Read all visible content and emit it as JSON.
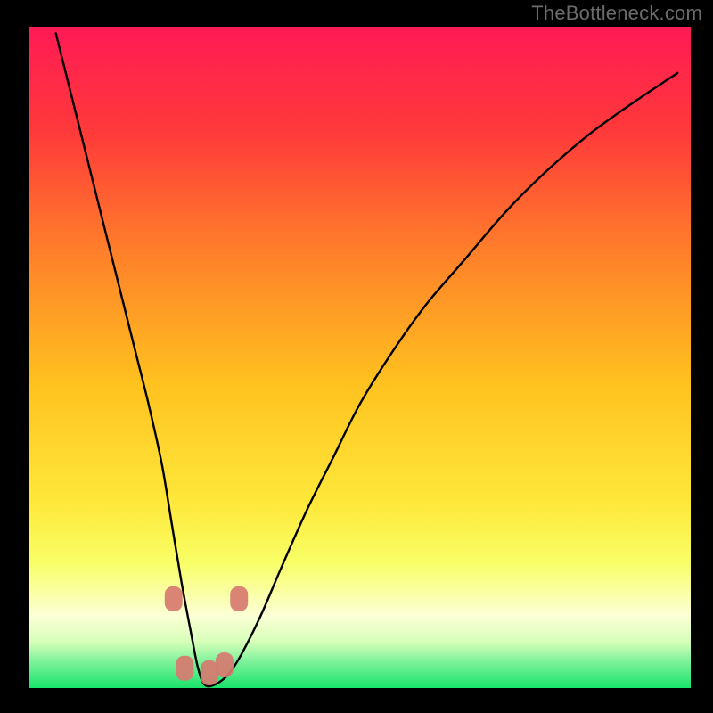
{
  "watermark": "TheBottleneck.com",
  "colors": {
    "black": "#000000",
    "curve": "#000000",
    "marker": "#d77a70",
    "grad_top": "#ff1a55",
    "grad_mid_upper": "#ff7f2a",
    "grad_mid": "#ffd21f",
    "grad_mid_lower": "#f8ff66",
    "grad_pale_yellow": "#fcffd4",
    "grad_green": "#19e36b"
  },
  "chart_data": {
    "type": "line",
    "title": "",
    "xlabel": "",
    "ylabel": "",
    "xlim": [
      0,
      100
    ],
    "ylim": [
      0,
      100
    ],
    "series": [
      {
        "name": "curve",
        "x": [
          4,
          6,
          8,
          10,
          12,
          14,
          16,
          18,
          20,
          21.5,
          23,
          24.5,
          25.5,
          26.5,
          28,
          30,
          32,
          35,
          38,
          42,
          46,
          50,
          55,
          60,
          66,
          72,
          78,
          85,
          92,
          98
        ],
        "values": [
          99,
          91,
          83,
          75,
          67,
          59,
          51,
          43,
          34,
          25,
          16,
          8,
          3,
          0.5,
          0.5,
          2,
          5,
          11,
          18,
          27,
          35,
          43,
          51,
          58,
          65,
          72,
          78,
          84,
          89,
          93
        ]
      }
    ],
    "markers": [
      {
        "x": 21.8,
        "y": 13.5
      },
      {
        "x": 23.5,
        "y": 3.0
      },
      {
        "x": 27.2,
        "y": 2.3
      },
      {
        "x": 29.5,
        "y": 3.5
      },
      {
        "x": 31.7,
        "y": 13.5
      }
    ],
    "marker_style": {
      "shape": "rounded-rect",
      "color": "#d77a70",
      "opacity": 0.92
    }
  }
}
